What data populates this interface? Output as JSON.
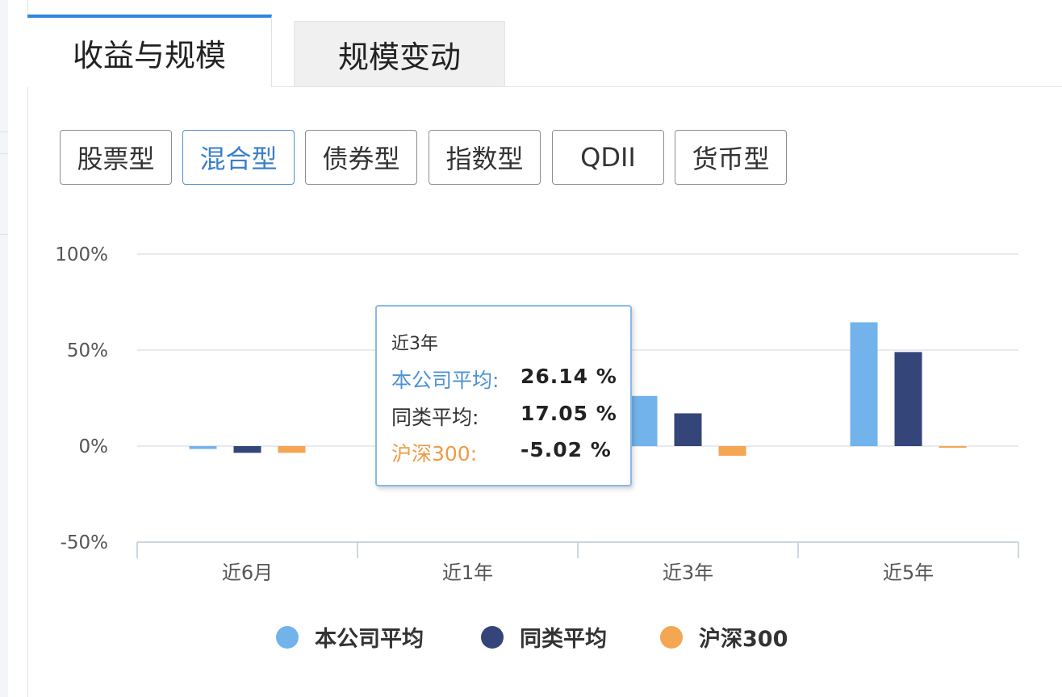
{
  "tabs": [
    {
      "label": "收益与规模",
      "active": true
    },
    {
      "label": "规模变动",
      "active": false
    }
  ],
  "fund_types": [
    {
      "label": "股票型",
      "active": false
    },
    {
      "label": "混合型",
      "active": true
    },
    {
      "label": "债券型",
      "active": false
    },
    {
      "label": "指数型",
      "active": false
    },
    {
      "label": "QDII",
      "active": false
    },
    {
      "label": "货币型",
      "active": false
    }
  ],
  "chart_data": {
    "type": "bar",
    "categories": [
      "近6月",
      "近1年",
      "近3年",
      "近5年"
    ],
    "series": [
      {
        "name": "本公司平均",
        "color": "#72b3ec",
        "values": [
          -1.5,
          null,
          26.14,
          64.5
        ]
      },
      {
        "name": "同类平均",
        "color": "#34457a",
        "values": [
          -3.5,
          null,
          17.05,
          49.0
        ]
      },
      {
        "name": "沪深300",
        "color": "#f4a653",
        "values": [
          -3.5,
          null,
          -5.02,
          -0.5
        ]
      }
    ],
    "y_ticks": [
      "100%",
      "50%",
      "0%",
      "-50%"
    ],
    "ylim": [
      -50,
      100
    ],
    "grid": true,
    "legend_position": "bottom-center",
    "tooltip": {
      "title": "近3年",
      "rows": [
        {
          "label": "本公司平均:",
          "value": "26.14 %",
          "color": "#4e92d4"
        },
        {
          "label": "同类平均:",
          "value": "17.05 %",
          "color": "#333333"
        },
        {
          "label": "沪深300:",
          "value": "-5.02 %",
          "color": "#f09a45"
        }
      ]
    }
  }
}
